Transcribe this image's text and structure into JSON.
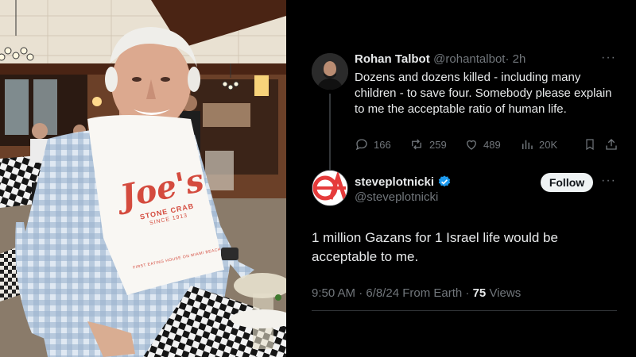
{
  "photo": {
    "bib_logo": "Joe's",
    "bib_stone_crab": "STONE CRAB",
    "bib_since": "SINCE 1913",
    "bib_tagline": "FIRST EATING HOUSE ON MIAMI BEACH"
  },
  "reply_tweet": {
    "name": "Rohan Talbot",
    "handle": "@rohantalbot",
    "time": "· 2h",
    "more": "···",
    "text": "Dozens and dozens killed - including many children - to save four. Somebody please explain to me the acceptable ratio of human life.",
    "stats": {
      "replies": "166",
      "retweets": "259",
      "likes": "489",
      "views": "20K"
    }
  },
  "main_tweet": {
    "name": "steveplotnicki",
    "handle": "@steveplotnicki",
    "follow_label": "Follow",
    "more": "···",
    "text": "1 million Gazans for 1 Israel life would be acceptable to me.",
    "timestamp": "9:50 AM · 6/8/24 From Earth · ",
    "views_count": "75",
    "views_label": " Views"
  },
  "colors": {
    "verified": "#1d9bf0",
    "muted": "#71767b",
    "text": "#e7e9ea"
  }
}
